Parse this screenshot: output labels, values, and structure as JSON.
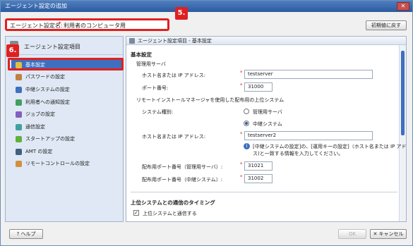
{
  "window": {
    "title": "エージェント設定の追加",
    "close": "✕"
  },
  "callouts": {
    "c5": "5.",
    "c6": "6."
  },
  "namebar": {
    "label": "エージェント設定名:",
    "required_mark": "*",
    "value": "利用者のコンピュータ用"
  },
  "reset_button": "初期値に戻す",
  "sidebar": {
    "header": "エージェント設定項目",
    "items": [
      {
        "label": "基本設定",
        "icon": "person-icon",
        "color": "#e0c040"
      },
      {
        "label": "パスワードの設定",
        "icon": "key-icon",
        "color": "#c08040"
      },
      {
        "label": "中継システムの設定",
        "icon": "network-icon",
        "color": "#4070c0"
      },
      {
        "label": "利用者への通知設定",
        "icon": "users-icon",
        "color": "#40a060"
      },
      {
        "label": "ジョブの設定",
        "icon": "job-icon",
        "color": "#8060c0"
      },
      {
        "label": "通信設定",
        "icon": "comm-icon",
        "color": "#40a0a0"
      },
      {
        "label": "スタートアップの設定",
        "icon": "startup-icon",
        "color": "#60b040"
      },
      {
        "label": "AMT の設定",
        "icon": "amt-icon",
        "color": "#406080"
      },
      {
        "label": "リモートコントロールの設定",
        "icon": "remote-icon",
        "color": "#d09040"
      }
    ]
  },
  "main": {
    "header": "エージェント設定項目 - 基本設定",
    "section_title": "基本設定",
    "mgmt_server": "管理用サーバ",
    "host_label": "ホスト名または IP アドレス:",
    "host_value": "testserver",
    "port_label": "ポート番号:",
    "port_value": "31000",
    "remote_install": "リモートインストールマネージャを使用した配布用の上位システム",
    "system_type": "システム種別:",
    "radio_mgmt": "管理用サーバ",
    "radio_relay": "中継システム",
    "host2_label": "ホスト名または IP アドレス:",
    "host2_value": "testserver2",
    "info_line1": "[中継システムの設定]の、[運用キーの設定]（ホスト名または IP アドレ",
    "info_line2": "ス)と一致する情報を入力してください。",
    "dist_port_mgmt_label": "配布用ポート番号（管理用サーバ）:",
    "dist_port_mgmt_value": "31021",
    "dist_port_relay_label": "配布用ポート番号（中継システム）:",
    "dist_port_relay_value": "31002",
    "timing_title": "上位システムとの通信のタイミング",
    "timing_check": "上位システムと通信する",
    "required_mark": "*"
  },
  "footer": {
    "help": "ヘルプ",
    "ok": "OK",
    "cancel": "キャンセル"
  }
}
